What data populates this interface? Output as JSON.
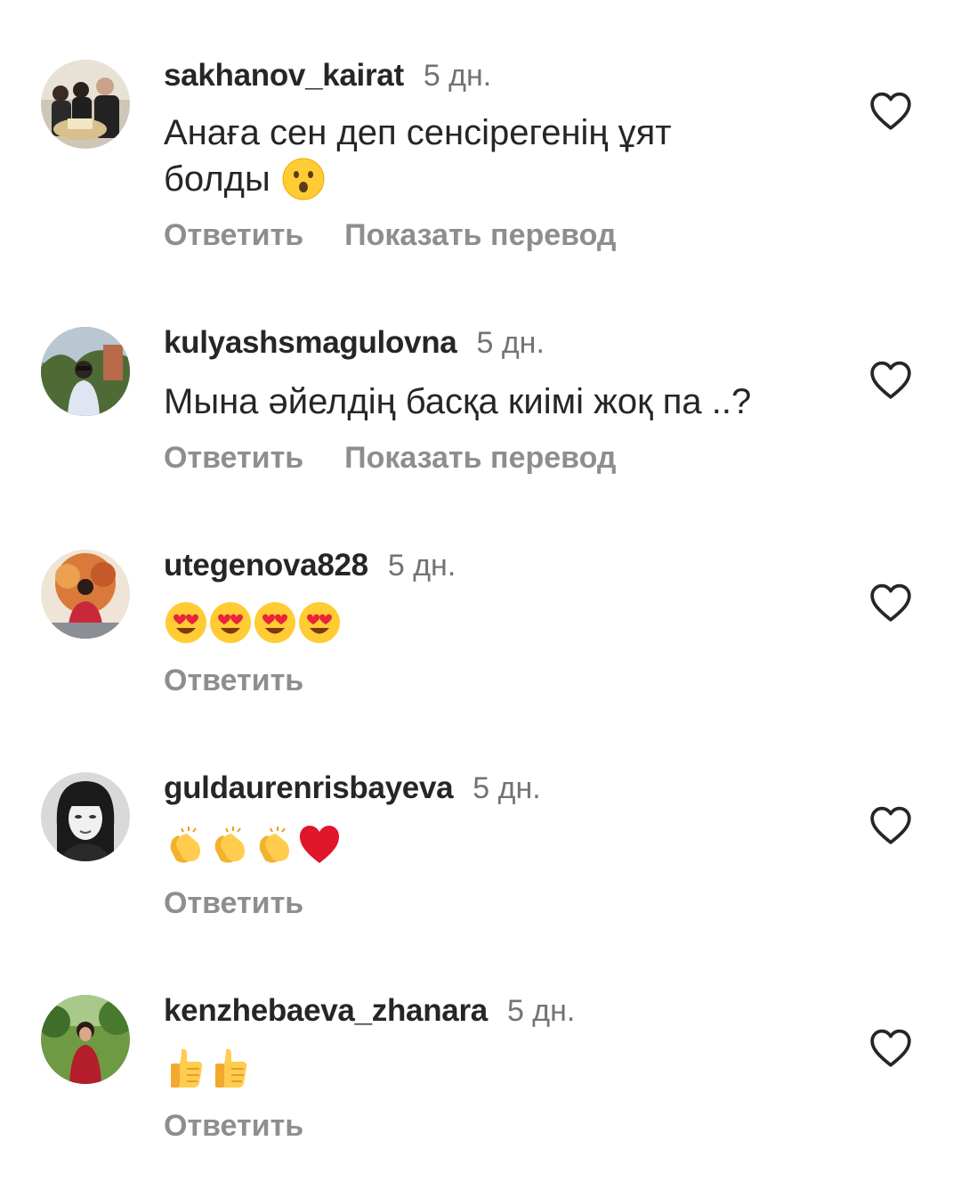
{
  "comments": [
    {
      "username": "sakhanov_kairat",
      "time": "5 дн.",
      "text_line1": "Анаға сен деп сенсірегенің ұят",
      "text_line2": "болды",
      "reply_label": "Ответить",
      "translate_label": "Показать перевод",
      "emojis": [
        "hushed-face-emoji"
      ]
    },
    {
      "username": "kulyashsmagulovna",
      "time": "5 дн.",
      "text": "Мына әйелдің басқа киімі жоқ па ..?",
      "reply_label": "Ответить",
      "translate_label": "Показать перевод"
    },
    {
      "username": "utegenova828",
      "time": "5 дн.",
      "reply_label": "Ответить",
      "emojis": [
        "heart-eyes-emoji",
        "heart-eyes-emoji",
        "heart-eyes-emoji",
        "heart-eyes-emoji"
      ]
    },
    {
      "username": "guldaurenrisbayeva",
      "time": "5 дн.",
      "reply_label": "Ответить",
      "emojis": [
        "clapping-hands-emoji",
        "clapping-hands-emoji",
        "clapping-hands-emoji",
        "red-heart-emoji"
      ]
    },
    {
      "username": "kenzhebaeva_zhanara",
      "time": "5 дн.",
      "reply_label": "Ответить",
      "emojis": [
        "thumbs-up-emoji",
        "thumbs-up-emoji"
      ]
    }
  ],
  "icons": {
    "like": "heart-outline-icon"
  },
  "colors": {
    "username": "#262626",
    "secondary": "#737373",
    "action": "#8e8e8e",
    "background": "#ffffff"
  }
}
